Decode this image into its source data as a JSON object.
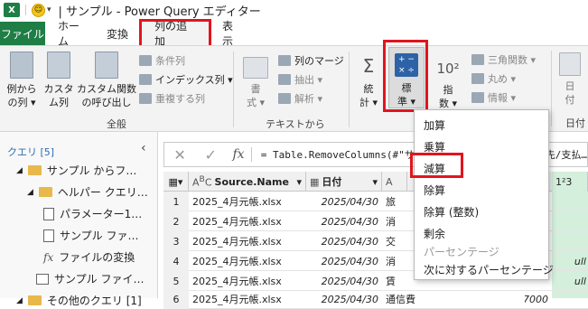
{
  "title_bar": {
    "logo": "X",
    "title": "| サンプル - Power Query エディター"
  },
  "tabs": [
    "ファイル",
    "ホーム",
    "変換",
    "列の追加",
    "表示"
  ],
  "ribbon": {
    "btn_example_1": "例から",
    "btn_example_2": "の列 ▾",
    "btn_custom_1": "カスタ",
    "btn_custom_2": "ム列",
    "btn_invoke_1": "カスタム関数",
    "btn_invoke_2": "の呼び出し",
    "cond_col": "条件列",
    "index_col": "インデックス列 ▾",
    "dup_col": "重複する列",
    "format_1": "書",
    "format_2": "式 ▾",
    "merge_cols": "列のマージ",
    "extract": "抽出 ▾",
    "parse": "解析 ▾",
    "stats_1": "統",
    "stats_2": "計 ▾",
    "std_1": "標",
    "std_2": "準 ▾",
    "sci_1": "指",
    "sci_2": "数 ▾",
    "trig": "三角関数 ▾",
    "round": "丸め ▾",
    "info": "情報 ▾",
    "date_1": "日",
    "date_2": "付",
    "group_general": "全般",
    "group_text": "テキストから",
    "group_date": "日付"
  },
  "queries": {
    "header": "クエリ [5]",
    "items": [
      "サンプル からフ…",
      "ヘルパー クエリ…",
      "パラメーター1…",
      "サンプル ファ…",
      "ファイルの変換",
      "サンプル ファイ…",
      "その他のクエリ [1]"
    ]
  },
  "formula": {
    "cancel": "✕",
    "confirm": "✓",
    "fx": "fx",
    "text": "= Table.RemoveColumns(#\"サンプル ファイル…\", {\"支払先/支払…"
  },
  "grid": {
    "columns": [
      "Source.Name",
      "日付",
      "勘",
      "1²3"
    ],
    "rows": [
      {
        "num": "1",
        "source": "2025_4月元帳.xlsx",
        "date": "2025/04/30",
        "account": "旅",
        "val": ""
      },
      {
        "num": "2",
        "source": "2025_4月元帳.xlsx",
        "date": "2025/04/30",
        "account": "消",
        "val": ""
      },
      {
        "num": "3",
        "source": "2025_4月元帳.xlsx",
        "date": "2025/04/30",
        "account": "交",
        "val": ""
      },
      {
        "num": "4",
        "source": "2025_4月元帳.xlsx",
        "date": "2025/04/30",
        "account": "消",
        "val": "ull"
      },
      {
        "num": "5",
        "source": "2025_4月元帳.xlsx",
        "date": "2025/04/30",
        "account": "賃",
        "val": "ull"
      },
      {
        "num": "6",
        "source": "2025_4月元帳.xlsx",
        "date": "2025/04/30",
        "account": "通信費",
        "val": "7000"
      }
    ]
  },
  "dropdown": {
    "items": [
      "加算",
      "乗算",
      "減算",
      "除算",
      "除算 (整数)",
      "剰余",
      "パーセンテージ",
      "次に対するパーセンテージ"
    ]
  }
}
